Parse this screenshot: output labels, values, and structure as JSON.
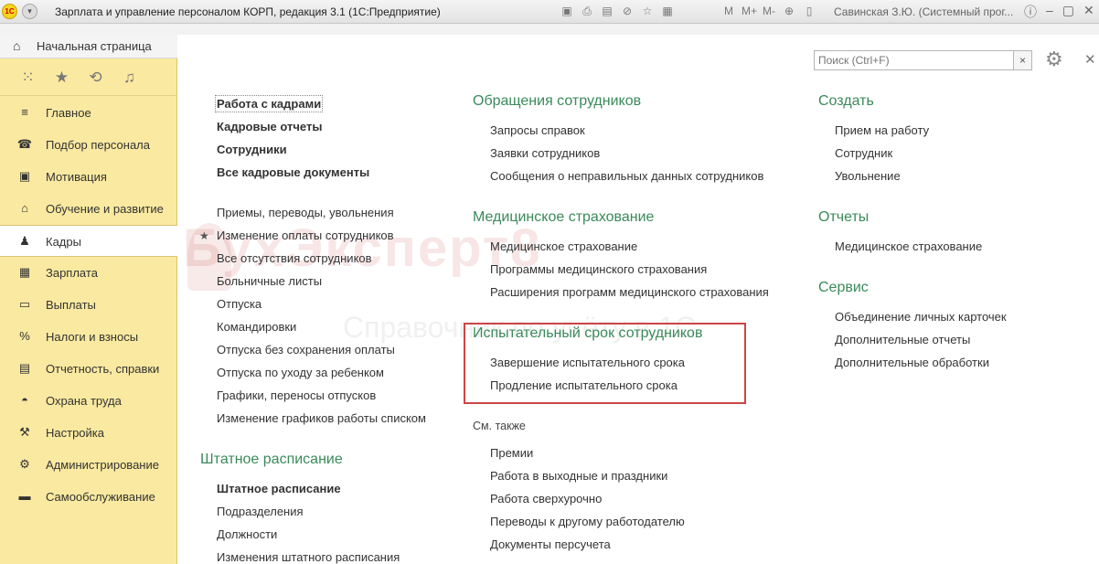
{
  "titlebar": {
    "app_title": "Зарплата и управление персоналом КОРП, редакция 3.1  (1С:Предприятие)",
    "logo": "1С",
    "user": "Савинская З.Ю. (Системный прог...",
    "memory_buttons": [
      "M",
      "M+",
      "M-"
    ]
  },
  "home_tab": {
    "label": "Начальная страница"
  },
  "quick_icons": [
    "apps-icon",
    "star-icon",
    "history-icon",
    "bell-icon"
  ],
  "sidebar": {
    "items": [
      {
        "label": "Главное",
        "icon": "menu-icon"
      },
      {
        "label": "Подбор персонала",
        "icon": "phone-icon"
      },
      {
        "label": "Мотивация",
        "icon": "briefcase-icon"
      },
      {
        "label": "Обучение и развитие",
        "icon": "graduation-icon"
      },
      {
        "label": "Кадры",
        "icon": "people-icon"
      },
      {
        "label": "Зарплата",
        "icon": "calculator-icon"
      },
      {
        "label": "Выплаты",
        "icon": "wallet-icon"
      },
      {
        "label": "Налоги и взносы",
        "icon": "percent-icon"
      },
      {
        "label": "Отчетность, справки",
        "icon": "report-icon"
      },
      {
        "label": "Охрана труда",
        "icon": "helmet-icon"
      },
      {
        "label": "Настройка",
        "icon": "wrench-icon"
      },
      {
        "label": "Администрирование",
        "icon": "gear-icon"
      },
      {
        "label": "Самообслуживание",
        "icon": "card-icon"
      }
    ],
    "active": "Кадры"
  },
  "search": {
    "placeholder": "Поиск (Ctrl+F)",
    "clear": "×"
  },
  "col1": {
    "bold_items": [
      "Работа с кадрами",
      "Кадровые отчеты",
      "Сотрудники",
      "Все кадровые документы"
    ],
    "items": [
      "Приемы, переводы, увольнения",
      "Изменение оплаты сотрудников",
      "Все отсутствия сотрудников",
      "Больничные листы",
      "Отпуска",
      "Командировки",
      "Отпуска без сохранения оплаты",
      "Отпуска по уходу за ребенком",
      "Графики, переносы отпусков",
      "Изменение графиков работы списком"
    ],
    "staff_section": {
      "title": "Штатное расписание",
      "items": [
        "Штатное расписание",
        "Подразделения",
        "Должности",
        "Изменения штатного расписания"
      ]
    }
  },
  "col2": {
    "sections": [
      {
        "title": "Обращения сотрудников",
        "items": [
          "Запросы справок",
          "Заявки сотрудников",
          "Сообщения о неправильных данных сотрудников"
        ]
      },
      {
        "title": "Медицинское страхование",
        "items": [
          "Медицинское страхование",
          "Программы медицинского страхования",
          "Расширения программ медицинского страхования"
        ]
      },
      {
        "title": "Испытательный срок сотрудников",
        "items": [
          "Завершение испытательного срока",
          "Продление испытательного срока"
        ]
      }
    ],
    "see_also": {
      "title": "См. также",
      "items": [
        "Премии",
        "Работа в выходные и праздники",
        "Работа сверхурочно",
        "Переводы к другому работодателю",
        "Документы персучета"
      ]
    }
  },
  "col3": {
    "sections": [
      {
        "title": "Создать",
        "items": [
          "Прием на работу",
          "Сотрудник",
          "Увольнение"
        ]
      },
      {
        "title": "Отчеты",
        "items": [
          "Медицинское страхование"
        ]
      },
      {
        "title": "Сервис",
        "items": [
          "Объединение личных карточек",
          "Дополнительные отчеты",
          "Дополнительные обработки"
        ]
      }
    ]
  },
  "watermark": {
    "brand": "БухЭксперт8",
    "tagline": "Справочник по учёту в 1С"
  },
  "colors": {
    "sidebar_bg": "#fae9a0",
    "section_title": "#3a8a5a",
    "highlight_box": "#cc4444"
  }
}
